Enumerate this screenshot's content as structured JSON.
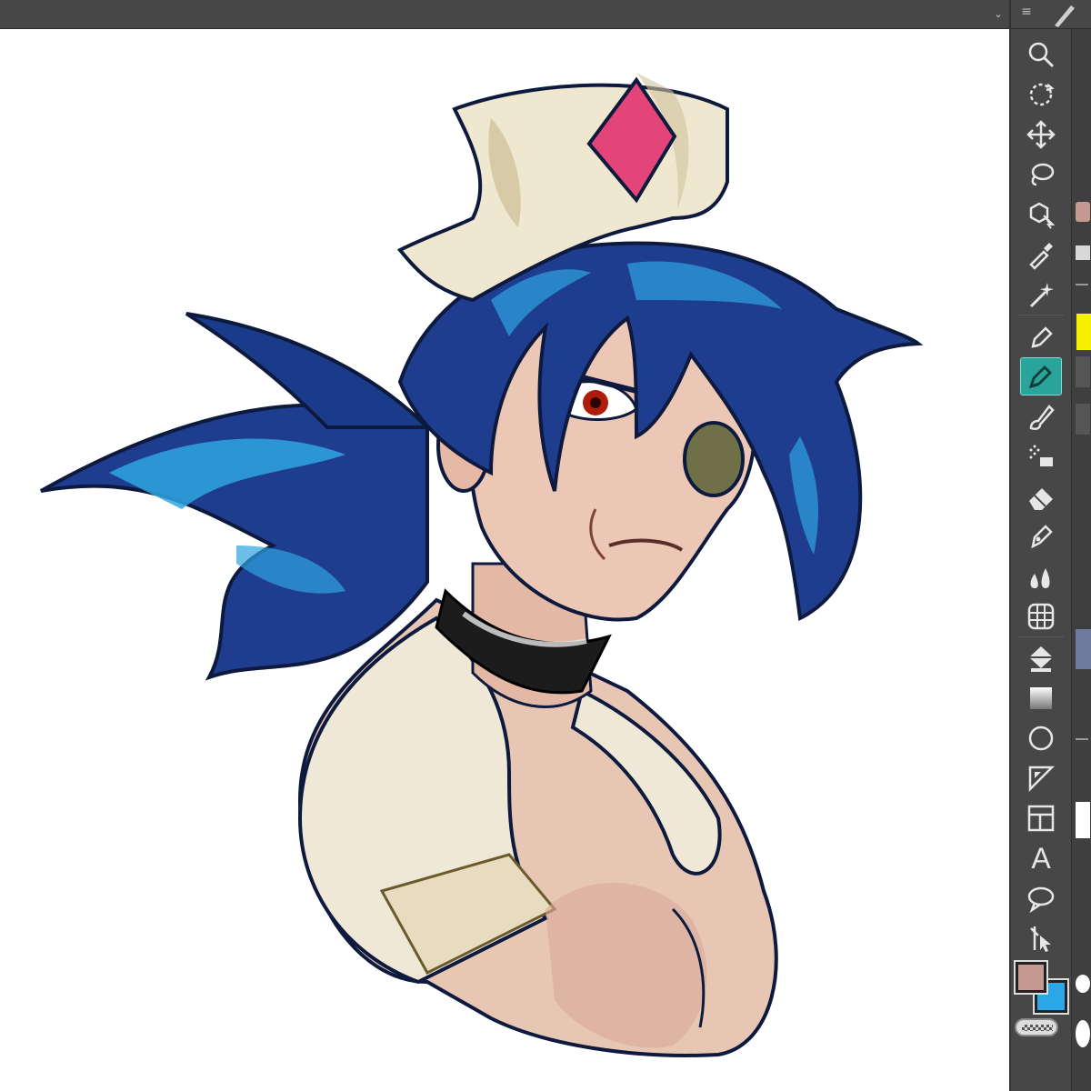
{
  "app": {
    "accent_color": "#2aa39a",
    "chrome_color": "#474747",
    "canvas_color": "#ffffff"
  },
  "topbar": {
    "collapse_icon": "chevron-down-icon",
    "menu_icon": "hamburger-icon",
    "brush_icon": "brush-icon"
  },
  "toolbar": {
    "tools": [
      {
        "name": "zoom",
        "icon": "zoom-icon"
      },
      {
        "name": "rotate",
        "icon": "rotate-icon"
      },
      {
        "name": "move",
        "icon": "move-icon"
      },
      {
        "name": "lasso-select",
        "icon": "lasso-select-icon"
      },
      {
        "name": "object",
        "icon": "object-select-icon"
      },
      {
        "name": "eyedropper",
        "icon": "eyedropper-icon"
      },
      {
        "name": "auto-select",
        "icon": "magic-wand-icon"
      },
      {
        "name": "pen",
        "icon": "pen-icon"
      },
      {
        "name": "pen-active",
        "icon": "pen-nib-icon",
        "active": true
      },
      {
        "name": "brush",
        "icon": "brush-icon"
      },
      {
        "name": "airbrush",
        "icon": "airbrush-icon"
      },
      {
        "name": "eraser",
        "icon": "eraser-icon"
      },
      {
        "name": "decoration",
        "icon": "decoration-pen-icon"
      },
      {
        "name": "blend",
        "icon": "blend-icon"
      },
      {
        "name": "perspective",
        "icon": "perspective-grid-icon"
      },
      {
        "name": "fill",
        "icon": "fill-bucket-icon"
      },
      {
        "name": "gradient",
        "icon": "gradient-icon"
      },
      {
        "name": "figure",
        "icon": "circle-icon"
      },
      {
        "name": "ruler",
        "icon": "ruler-icon"
      },
      {
        "name": "frame",
        "icon": "frame-border-icon"
      },
      {
        "name": "text",
        "icon": "text-icon",
        "glyph": "A"
      },
      {
        "name": "balloon",
        "icon": "speech-balloon-icon"
      },
      {
        "name": "correct-line",
        "icon": "correct-line-icon"
      }
    ]
  },
  "colors": {
    "main": "#c49a90",
    "sub": "#29a7e6",
    "transparent_label_icon": "transparency-icon"
  }
}
